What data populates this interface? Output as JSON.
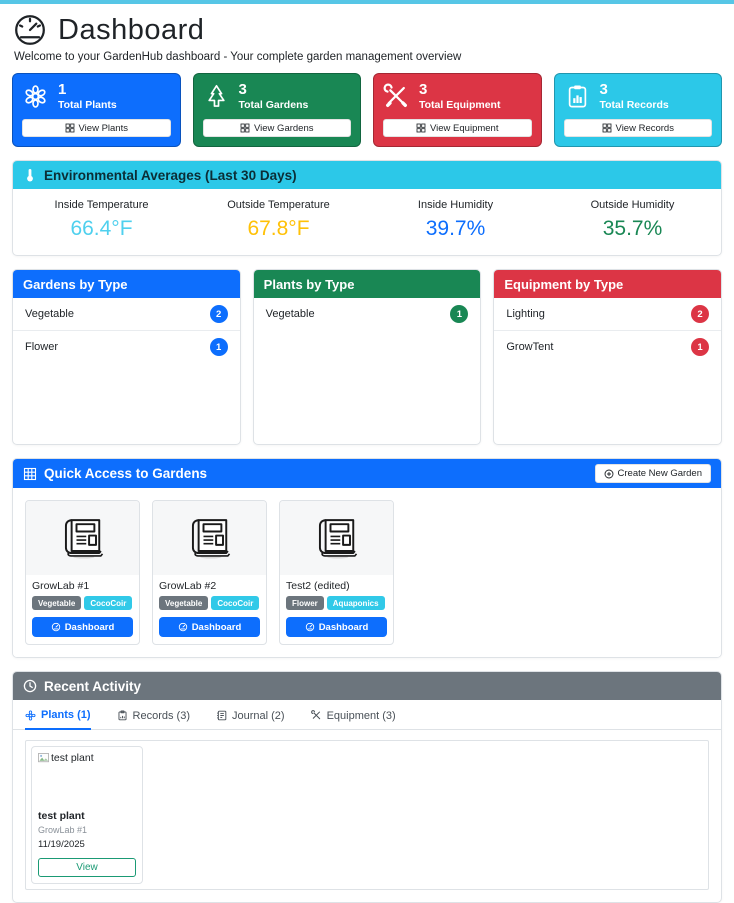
{
  "colors": {
    "primary": "#0d6efd",
    "success": "#198754",
    "danger": "#dc3545",
    "info": "#2cc8e8",
    "secondary": "#6c757d",
    "warning": "#ffc107",
    "badge_gray": "#6c757d",
    "badge_cyan": "#31c9e8",
    "view_teal": "#1a9a74",
    "accent_bar": "#56c6e6"
  },
  "page": {
    "title": "Dashboard",
    "subtitle": "Welcome to your GardenHub dashboard - Your complete garden management overview"
  },
  "stats": [
    {
      "count": "1",
      "label": "Total Plants",
      "button": "View Plants",
      "color": "#0d6efd",
      "icon": "flower-icon"
    },
    {
      "count": "3",
      "label": "Total Gardens",
      "button": "View Gardens",
      "color": "#198754",
      "icon": "tree-icon"
    },
    {
      "count": "3",
      "label": "Total Equipment",
      "button": "View Equipment",
      "color": "#dc3545",
      "icon": "tools-icon"
    },
    {
      "count": "3",
      "label": "Total Records",
      "button": "View Records",
      "color": "#2cc8e8",
      "icon": "clipboard-chart-icon"
    }
  ],
  "environment": {
    "title": "Environmental Averages (Last 30 Days)",
    "header_color": "#2cc8e8",
    "metrics": [
      {
        "label": "Inside Temperature",
        "value": "66.4°F",
        "color": "#4fd0ee"
      },
      {
        "label": "Outside Temperature",
        "value": "67.8°F",
        "color": "#ffc107"
      },
      {
        "label": "Inside Humidity",
        "value": "39.7%",
        "color": "#0d6efd"
      },
      {
        "label": "Outside Humidity",
        "value": "35.7%",
        "color": "#198754"
      }
    ]
  },
  "type_cards": [
    {
      "title": "Gardens by Type",
      "color": "#0d6efd",
      "rows": [
        {
          "label": "Vegetable",
          "count": "2"
        },
        {
          "label": "Flower",
          "count": "1"
        }
      ]
    },
    {
      "title": "Plants by Type",
      "color": "#198754",
      "rows": [
        {
          "label": "Vegetable",
          "count": "1"
        }
      ]
    },
    {
      "title": "Equipment by Type",
      "color": "#dc3545",
      "rows": [
        {
          "label": "Lighting",
          "count": "2"
        },
        {
          "label": "GrowTent",
          "count": "1"
        }
      ]
    }
  ],
  "quick_access": {
    "title": "Quick Access to Gardens",
    "header_color": "#0d6efd",
    "create_button": "Create New Garden",
    "gardens": [
      {
        "name": "GrowLab #1",
        "type_badge": "Vegetable",
        "medium_badge": "CocoCoir",
        "type_color": "#6c757d",
        "medium_color": "#31c9e8",
        "button": "Dashboard",
        "button_color": "#0d6efd"
      },
      {
        "name": "GrowLab #2",
        "type_badge": "Vegetable",
        "medium_badge": "CocoCoir",
        "type_color": "#6c757d",
        "medium_color": "#31c9e8",
        "button": "Dashboard",
        "button_color": "#0d6efd"
      },
      {
        "name": "Test2 (edited)",
        "type_badge": "Flower",
        "medium_badge": "Aquaponics",
        "type_color": "#6c757d",
        "medium_color": "#31c9e8",
        "button": "Dashboard",
        "button_color": "#0d6efd"
      }
    ]
  },
  "recent_activity": {
    "title": "Recent Activity",
    "header_color": "#6c757d",
    "tabs": [
      {
        "label": "Plants (1)",
        "active": true
      },
      {
        "label": "Records (3)",
        "active": false
      },
      {
        "label": "Journal (2)",
        "active": false
      },
      {
        "label": "Equipment (3)",
        "active": false
      }
    ],
    "plant_card": {
      "image_alt": "test plant",
      "name": "test plant",
      "garden": "GrowLab #1",
      "date": "11/19/2025",
      "button": "View",
      "button_color": "#1a9a74"
    }
  }
}
